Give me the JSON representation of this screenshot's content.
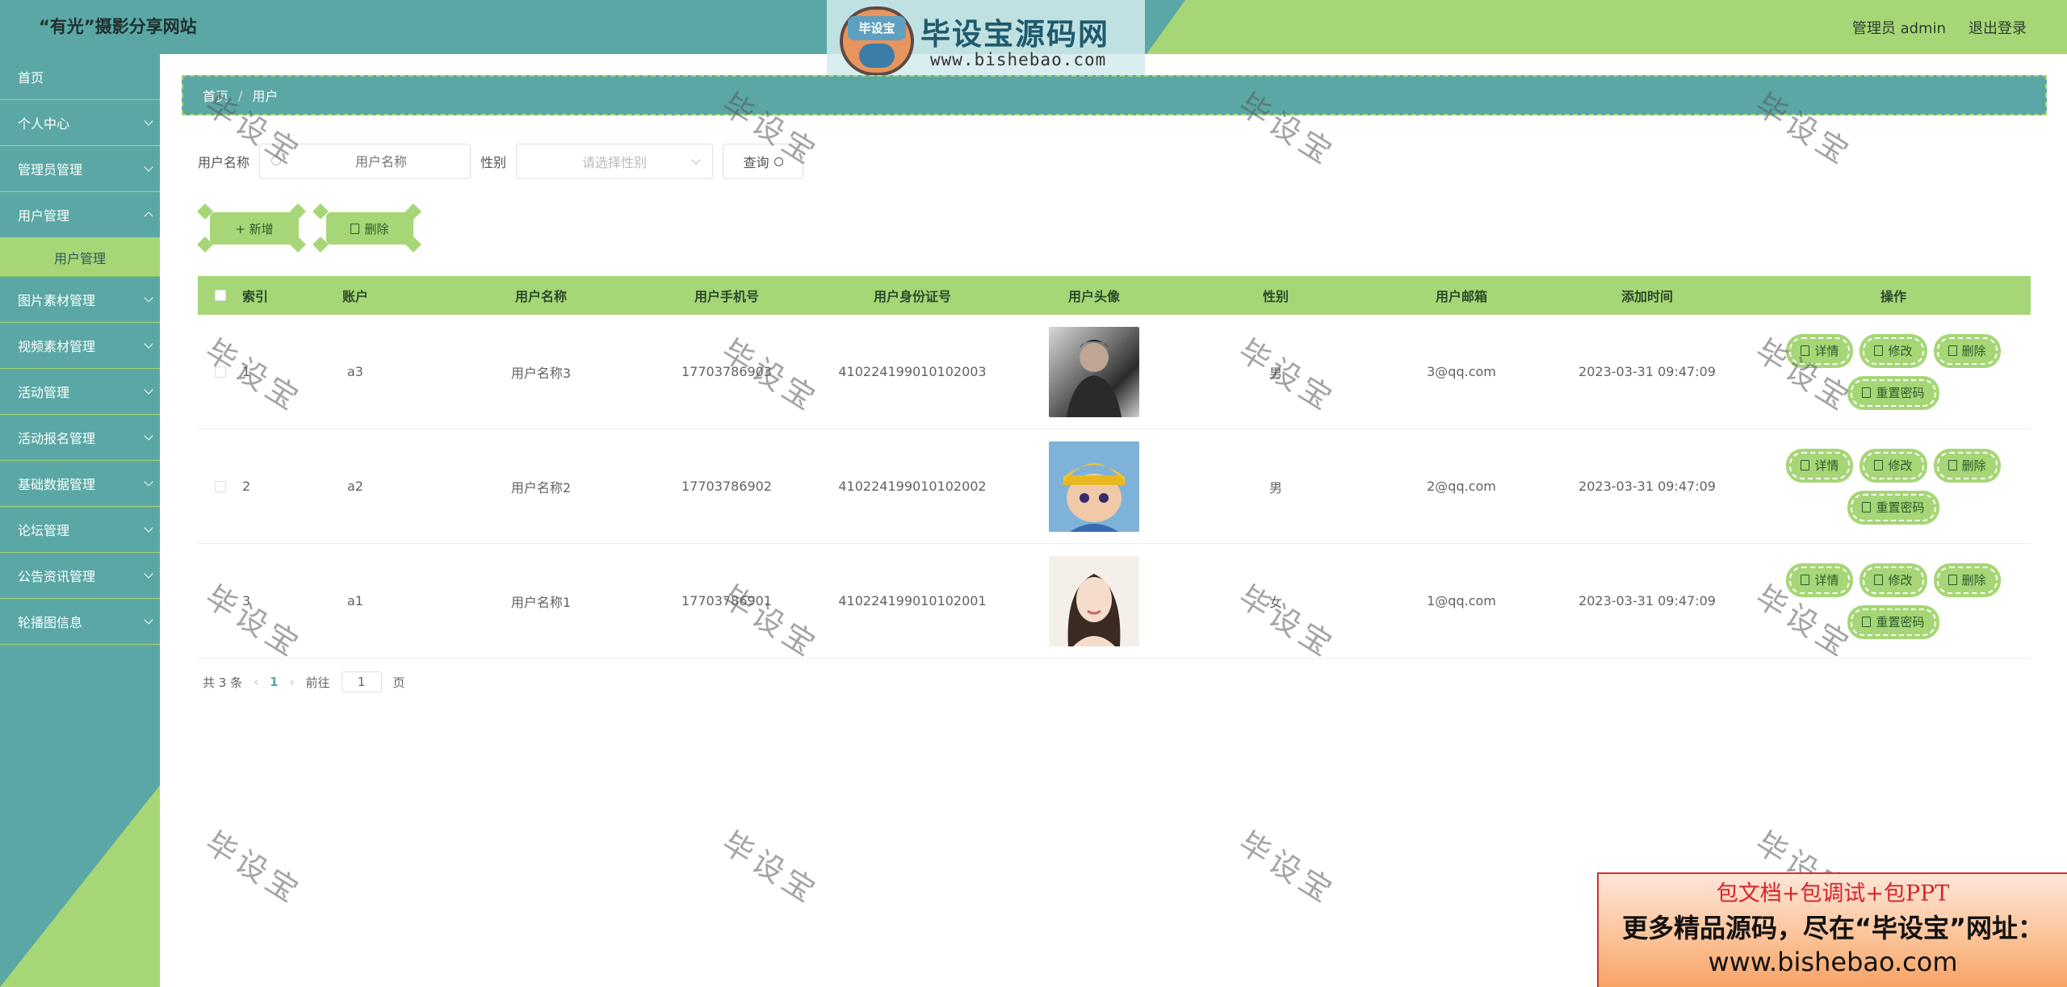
{
  "header": {
    "site_title": "“有光”摄影分享网站",
    "admin_label": "管理员 admin",
    "logout_label": "退出登录",
    "logo_badge": "毕设宝",
    "logo_text": "毕设宝源码网",
    "logo_url": "www.bishebao.com"
  },
  "sidebar": {
    "items": [
      {
        "label": "首页"
      },
      {
        "label": "个人中心"
      },
      {
        "label": "管理员管理"
      },
      {
        "label": "用户管理"
      },
      {
        "label": "用户管理"
      },
      {
        "label": "图片素材管理"
      },
      {
        "label": "视频素材管理"
      },
      {
        "label": "活动管理"
      },
      {
        "label": "活动报名管理"
      },
      {
        "label": "基础数据管理"
      },
      {
        "label": "论坛管理"
      },
      {
        "label": "公告资讯管理"
      },
      {
        "label": "轮播图信息"
      }
    ]
  },
  "breadcrumb": {
    "home": "首页",
    "current": "用户"
  },
  "search": {
    "name_label": "用户名称",
    "name_placeholder": "用户名称",
    "sex_label": "性别",
    "sex_placeholder": "请选择性别",
    "query_label": "查询"
  },
  "toolbar": {
    "add_label": "+ 新增",
    "delete_label": "删除"
  },
  "table": {
    "headers": [
      "索引",
      "账户",
      "用户名称",
      "用户手机号",
      "用户身份证号",
      "用户头像",
      "性别",
      "用户邮箱",
      "添加时间",
      "操作"
    ],
    "rows": [
      {
        "index": "1",
        "account": "a3",
        "name": "用户名称3",
        "phone": "17703786903",
        "id_card": "410224199010102003",
        "sex": "男",
        "email": "3@qq.com",
        "time": "2023-03-31 09:47:09"
      },
      {
        "index": "2",
        "account": "a2",
        "name": "用户名称2",
        "phone": "17703786902",
        "id_card": "410224199010102002",
        "sex": "男",
        "email": "2@qq.com",
        "time": "2023-03-31 09:47:09"
      },
      {
        "index": "3",
        "account": "a1",
        "name": "用户名称1",
        "phone": "17703786901",
        "id_card": "410224199010102001",
        "sex": "女",
        "email": "1@qq.com",
        "time": "2023-03-31 09:47:09"
      }
    ],
    "ops": {
      "detail": "详情",
      "edit": "修改",
      "delete": "删除",
      "reset": "重置密码"
    }
  },
  "pager": {
    "total": "共 3 条",
    "current": "1",
    "goto": "前往",
    "page_value": "1",
    "page_unit": "页"
  },
  "watermark": "毕设宝",
  "ad": {
    "line1": "包文档+包调试+包PPT",
    "line2": "更多精品源码，尽在“毕设宝”网址：",
    "line3": "www.bishebao.com"
  },
  "colors": {
    "teal": "#5aa7a5",
    "green": "#a6d676"
  }
}
